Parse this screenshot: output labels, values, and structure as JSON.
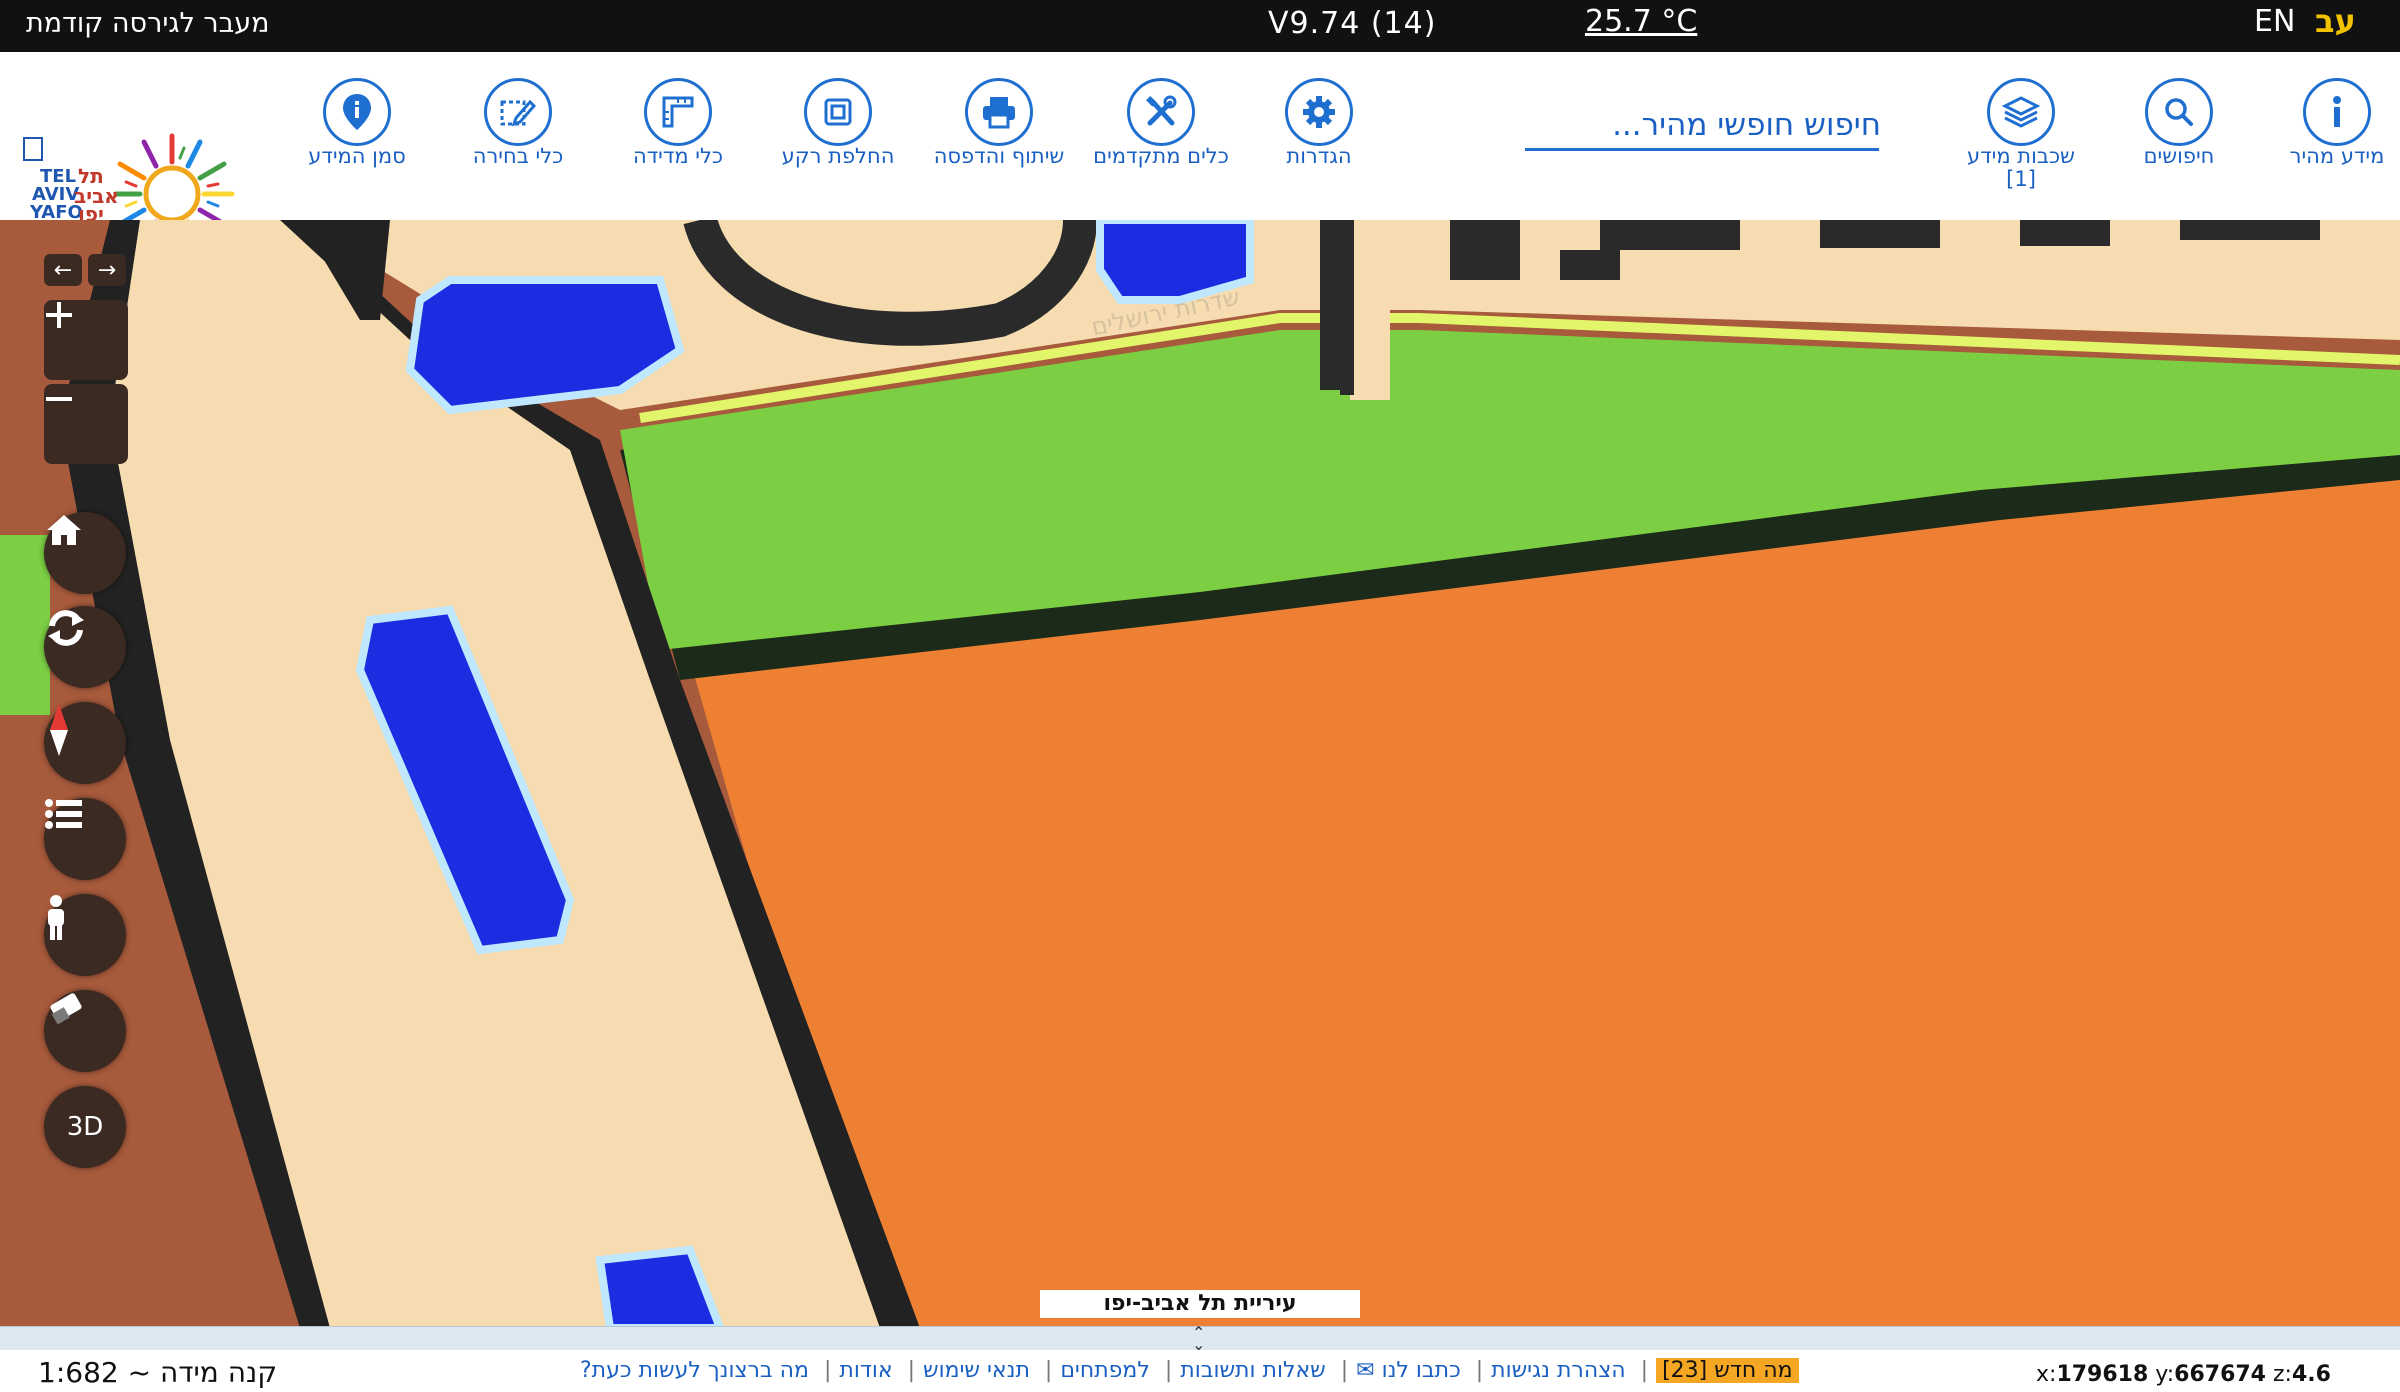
{
  "topbar": {
    "previous_version": "מעבר לגירסה קודמת",
    "version": "V9.74 (14)",
    "temperature": "25.7 °C",
    "lang_en": "EN",
    "lang_he": "עב"
  },
  "toolbar": {
    "info_marker": "סמן המידע",
    "selection_tools": "כלי בחירה",
    "measure_tools": "כלי מדידה",
    "basemap_switch": "החלפת רקע",
    "share_print": "שיתוף והדפסה",
    "advanced_tools": "כלים מתקדמים",
    "settings": "הגדרות",
    "search_placeholder": "חיפוש חופשי מהיר...",
    "info_layers": "שכבות מידע",
    "info_layers_count": "[1]",
    "searches": "חיפושים",
    "quick_info": "מידע מהיר"
  },
  "logo": {
    "en_line1": "TEL",
    "en_line2": "AVIV",
    "en_line3": "YAFO",
    "he_line1": "תל",
    "he_line2": "אביב",
    "he_line3": "יפו"
  },
  "map": {
    "city_label": "עיריית תל אביב-יפו",
    "street_label": "שדרות ירושלים",
    "controls": {
      "three_d": "3D"
    }
  },
  "footer": {
    "scale": "קנה מידה ~ 1:682",
    "links": [
      "מה ברצונך לעשות כעת?",
      "אודות",
      "תנאי שימוש",
      "למפתחים",
      "שאלות ותשובות",
      "כתבו לנו ✉",
      "הצהרת נגישות"
    ],
    "whats_new": "מה חדש [23]",
    "x_label": "x:",
    "x_value": "179618",
    "y_label": "y:",
    "y_value": "667674",
    "z_label": "z:",
    "z_value": "4.6"
  },
  "colors": {
    "accent": "#1f6fd0",
    "road_fill": "#f6dcb0",
    "park": "#7ccf43",
    "orange_zone": "#ed8033",
    "water_blue": "#1b2de0",
    "dark_border": "#2a2a2a"
  }
}
